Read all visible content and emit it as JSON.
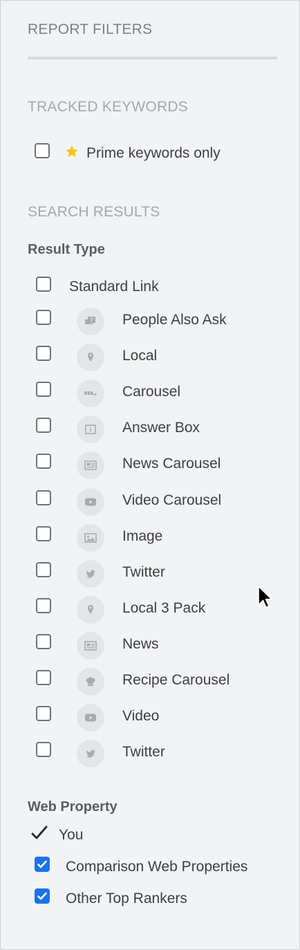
{
  "panel": {
    "title": "REPORT FILTERS"
  },
  "tracked_keywords": {
    "heading": "TRACKED KEYWORDS",
    "prime_only": {
      "label": "Prime keywords only",
      "checked": false,
      "icon": "star-icon"
    }
  },
  "search_results": {
    "heading": "SEARCH RESULTS",
    "result_type": {
      "label": "Result Type",
      "items": [
        {
          "label": "Standard Link",
          "checked": false,
          "icon": ""
        },
        {
          "label": "People Also Ask",
          "checked": false,
          "icon": "question-chat-icon"
        },
        {
          "label": "Local",
          "checked": false,
          "icon": "map-pin-icon"
        },
        {
          "label": "Carousel",
          "checked": false,
          "icon": "carousel-icon"
        },
        {
          "label": "Answer Box",
          "checked": false,
          "icon": "info-box-icon"
        },
        {
          "label": "News Carousel",
          "checked": false,
          "icon": "newspaper-icon"
        },
        {
          "label": "Video Carousel",
          "checked": false,
          "icon": "video-play-icon"
        },
        {
          "label": "Image",
          "checked": false,
          "icon": "image-icon"
        },
        {
          "label": "Twitter",
          "checked": false,
          "icon": "twitter-bird-icon"
        },
        {
          "label": "Local 3 Pack",
          "checked": false,
          "icon": "map-pin-icon"
        },
        {
          "label": "News",
          "checked": false,
          "icon": "newspaper-icon"
        },
        {
          "label": "Recipe Carousel",
          "checked": false,
          "icon": "chef-hat-icon"
        },
        {
          "label": "Video",
          "checked": false,
          "icon": "video-play-icon"
        },
        {
          "label": "Twitter",
          "checked": false,
          "icon": "twitter-bird-icon"
        }
      ]
    },
    "web_property": {
      "label": "Web Property",
      "items": [
        {
          "label": "You",
          "checked": true,
          "style": "plain-checkmark"
        },
        {
          "label": "Comparison Web Properties",
          "checked": true,
          "style": "checkbox"
        },
        {
          "label": "Other Top Rankers",
          "checked": true,
          "style": "checkbox"
        }
      ]
    }
  },
  "colors": {
    "panel_bg": "#f2f3f5",
    "checkbox_checked": "#1a73e8",
    "star": "#f5c518",
    "icon_bg": "#e3e5e8",
    "icon_fg": "#a7abb1"
  }
}
